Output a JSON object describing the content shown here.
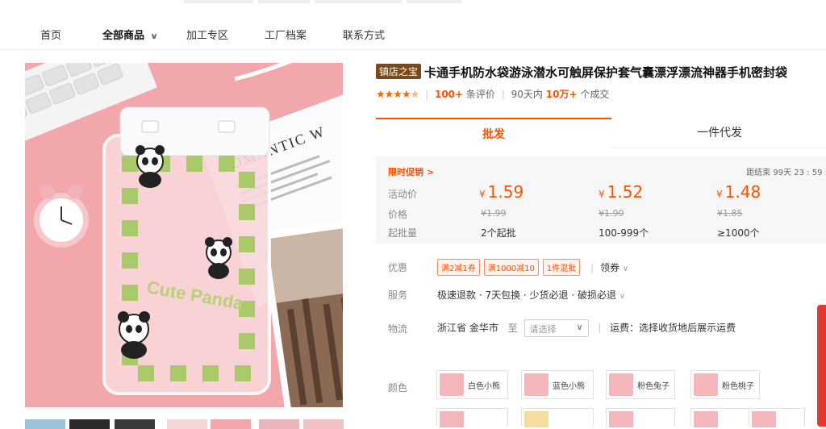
{
  "nav": {
    "items": [
      "首页",
      "全部商品",
      "加工专区",
      "工厂档案",
      "联系方式"
    ],
    "active_index": 1
  },
  "product": {
    "badge": "镇店之宝",
    "title": "卡通手机防水袋游泳潜水可触屏保护套气囊漂浮漂流神器手机密封袋",
    "rating": 4.5,
    "reviews_count": "100+",
    "reviews_label": "条评价",
    "sales_period": "90天内",
    "sales_count": "10万+",
    "sales_label": "个成交",
    "image_texts": [
      "ROMANTIC W",
      "Cute Panda"
    ]
  },
  "tabs": [
    "批发",
    "一件代发"
  ],
  "pricing": {
    "promo_label": "限时促销",
    "promo_arrow": ">",
    "countdown": "距结束 99天 23 : 59 :",
    "row_labels": [
      "活动价",
      "价格",
      "起批量"
    ],
    "currency": "¥",
    "tiers": [
      {
        "price": "1.59",
        "orig": "¥1.99",
        "moq": "2个起批"
      },
      {
        "price": "1.52",
        "orig": "¥1.90",
        "moq": "100-999个"
      },
      {
        "price": "1.48",
        "orig": "¥1.85",
        "moq": "≥1000个"
      }
    ]
  },
  "benefits": {
    "label": "优惠",
    "coupons": [
      "满2减1券",
      "满1000减10",
      "1件混批"
    ],
    "claim": "领券"
  },
  "service": {
    "label": "服务",
    "text": "极速退款 · 7天包换 · 少货必退 · 破损必退"
  },
  "logistics": {
    "label": "物流",
    "origin": "浙江省 金华市",
    "to": "至",
    "select_placeholder": "请选择",
    "shipping": "运费：选择收货地后展示运费"
  },
  "color": {
    "label": "颜色",
    "options": [
      "白色小熊",
      "蓝色小熊",
      "粉色兔子",
      "粉色桃子"
    ]
  },
  "colors": {
    "accent": "#ff5000",
    "badge": "#7a4a1c",
    "product_bg": "#f2a7ad",
    "panel_bg": "#f7f7f7"
  }
}
